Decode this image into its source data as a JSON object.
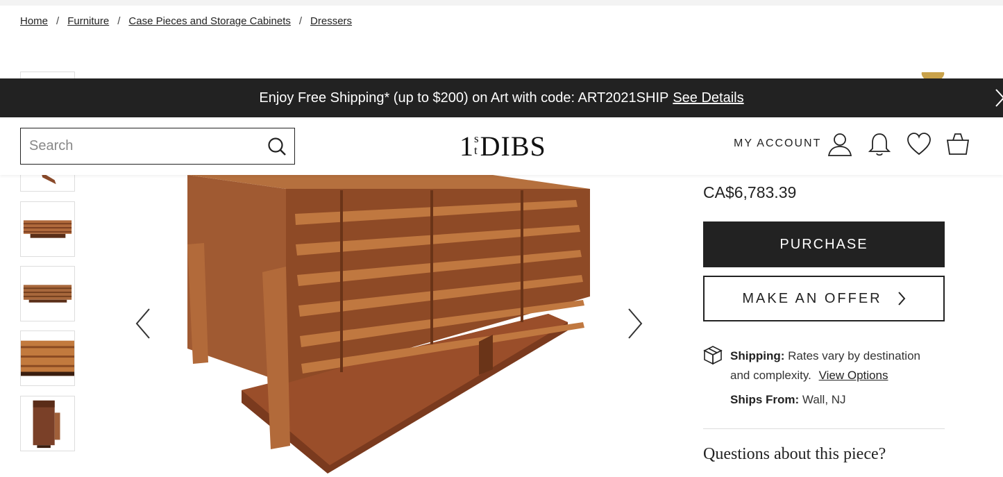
{
  "breadcrumb": {
    "items": [
      "Home",
      "Furniture",
      "Case Pieces and Storage Cabinets",
      "Dressers"
    ],
    "separator": "/"
  },
  "promo": {
    "text": "Enjoy Free Shipping* (up to $200) on Art with code: ART2021SHIP",
    "link": "See Details"
  },
  "header": {
    "search_placeholder": "Search",
    "logo": {
      "one": "1",
      "st_top": "s",
      "st_bottom": "t",
      "dibs": "DIBS"
    },
    "my_account": "MY ACCOUNT"
  },
  "product": {
    "price": "CA$6,783.39",
    "purchase_label": "PURCHASE",
    "offer_label": "MAKE AN OFFER",
    "shipping_label": "Shipping:",
    "shipping_text": "Rates vary by destination and complexity.",
    "view_options": "View Options",
    "ships_from_label": "Ships From:",
    "ships_from_value": "Wall, NJ",
    "questions": "Questions about this piece?"
  },
  "colors": {
    "dark": "#222222",
    "wood": "#9a5a36",
    "wood_dark": "#6e3a20",
    "gold": "#c9a24a"
  },
  "icons": [
    "search-icon",
    "user-icon",
    "bell-icon",
    "heart-icon",
    "bag-icon",
    "box-icon",
    "chevron-left-icon",
    "chevron-right-icon",
    "close-icon"
  ]
}
